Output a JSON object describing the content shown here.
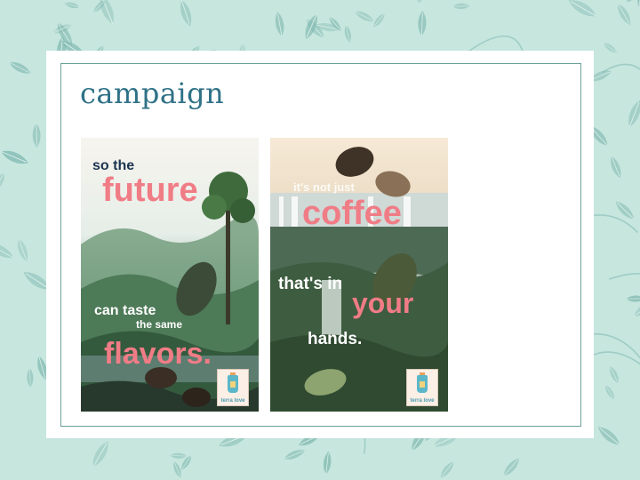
{
  "slide": {
    "title": "campaign"
  },
  "posters": [
    {
      "line1": "so the",
      "line2": "future",
      "line3": "can taste",
      "line4": "the same",
      "line5": "flavors.",
      "logo_text": "terra  love"
    },
    {
      "line1": "it's not just",
      "line2": "coffee",
      "line3": "that's in",
      "line4": "your",
      "line5": "hands.",
      "logo_text": "terra  love"
    }
  ],
  "colors": {
    "background": "#c6e6de",
    "leaf": "#7fb8b0",
    "title": "#2f7186",
    "accent_pink": "#f07c86",
    "navy": "#1c3550"
  }
}
